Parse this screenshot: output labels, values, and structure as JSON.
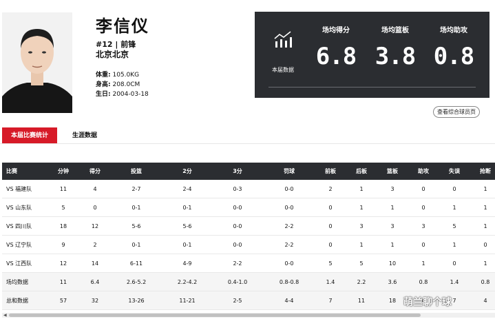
{
  "player": {
    "name": "李信仪",
    "number_position": "#12 | 前锋",
    "hometown": "北京北京",
    "weight_label": "体重:",
    "weight": "105.0KG",
    "height_label": "身高:",
    "height": "208.0CM",
    "birth_label": "生日:",
    "birth": "2004-03-18",
    "photo_icon": "player-portrait-icon"
  },
  "season_card": {
    "label": "本届数据",
    "icon": "bar-chart-icon",
    "stats": [
      {
        "header": "场均得分",
        "value": "6.8"
      },
      {
        "header": "场均篮板",
        "value": "3.8"
      },
      {
        "header": "场均助攻",
        "value": "0.8"
      }
    ]
  },
  "compare_button": "查看综合球员页",
  "tabs": {
    "active": "本届比赛统计",
    "inactive": "生涯数据"
  },
  "table": {
    "headers": [
      "比赛",
      "分钟",
      "得分",
      "投篮",
      "2分",
      "3分",
      "罚球",
      "前板",
      "后板",
      "篮板",
      "助攻",
      "失误",
      "抢断"
    ],
    "rows": [
      [
        "VS 福建队",
        "11",
        "4",
        "2-7",
        "2-4",
        "0-3",
        "0-0",
        "2",
        "1",
        "3",
        "0",
        "0",
        "1"
      ],
      [
        "VS 山东队",
        "5",
        "0",
        "0-1",
        "0-1",
        "0-0",
        "0-0",
        "0",
        "1",
        "1",
        "0",
        "1",
        "1"
      ],
      [
        "VS 四川队",
        "18",
        "12",
        "5-6",
        "5-6",
        "0-0",
        "2-2",
        "0",
        "3",
        "3",
        "3",
        "5",
        "1"
      ],
      [
        "VS 辽宁队",
        "9",
        "2",
        "0-1",
        "0-1",
        "0-0",
        "2-2",
        "0",
        "1",
        "1",
        "0",
        "1",
        "0"
      ],
      [
        "VS 江西队",
        "12",
        "14",
        "6-11",
        "4-9",
        "2-2",
        "0-0",
        "5",
        "5",
        "10",
        "1",
        "0",
        "1"
      ],
      [
        "场均数据",
        "11",
        "6.4",
        "2.6-5.2",
        "2.2-4.2",
        "0.4-1.0",
        "0.8-0.8",
        "1.4",
        "2.2",
        "3.6",
        "0.8",
        "1.4",
        "0.8"
      ],
      [
        "总和数据",
        "57",
        "32",
        "13-26",
        "11-21",
        "2-5",
        "4-4",
        "7",
        "11",
        "18",
        "4",
        "7",
        "4"
      ]
    ]
  },
  "watermark": "萌兰聊个球",
  "colors": {
    "accent_red": "#d71a28",
    "dark_panel": "#2b2d31"
  }
}
